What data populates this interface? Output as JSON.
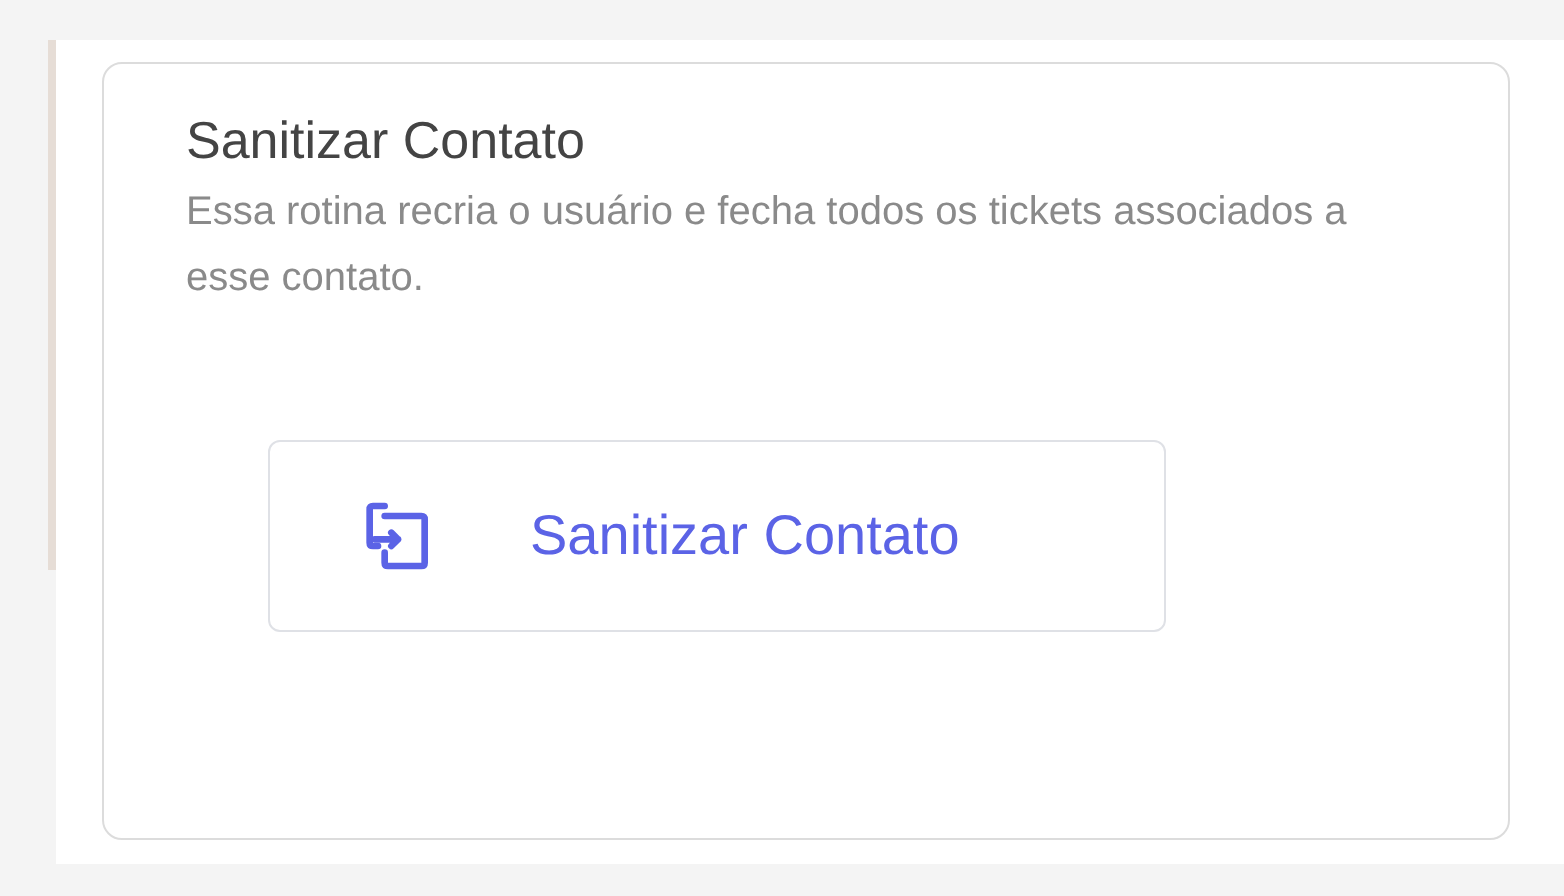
{
  "card": {
    "title": "Sanitizar Contato",
    "description": "Essa rotina recria o usuário e fecha todos os tickets associados a esse contato.",
    "button": {
      "label": "Sanitizar Contato"
    }
  }
}
